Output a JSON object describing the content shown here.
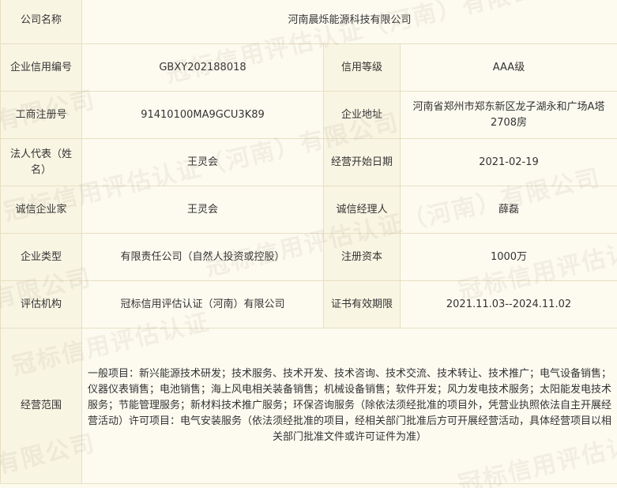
{
  "company": {
    "name_label": "公司名称",
    "name": "河南晨烁能源科技有限公司"
  },
  "credit": {
    "code_label": "企业信用编号",
    "code": "GBXY202188018",
    "level_label": "信用等级",
    "level": "AAA级"
  },
  "registration": {
    "number_label": "工商注册号",
    "number": "91410100MA9GCU3K89",
    "address_label": "企业地址",
    "address": "河南省郑州市郑东新区龙子湖永和广场A塔2708房"
  },
  "legal": {
    "rep_label": "法人代表（姓名）",
    "rep": "王灵会",
    "start_label": "经营开始日期",
    "start": "2021-02-19"
  },
  "integrity": {
    "entrepreneur_label": "诚信企业家",
    "entrepreneur": "王灵会",
    "manager_label": "诚信经理人",
    "manager": "薛磊"
  },
  "type": {
    "type_label": "企业类型",
    "type": "有限责任公司（自然人投资或控股）",
    "capital_label": "注册资本",
    "capital": "1000万"
  },
  "evaluation": {
    "org_label": "评估机构",
    "org": "冠标信用评估认证（河南）有限公司",
    "validity_label": "证书有效期限",
    "validity": "2021.11.03--2024.11.02"
  },
  "scope": {
    "label": "经营范围",
    "text": "一般项目：新兴能源技术研发；技术服务、技术开发、技术咨询、技术交流、技术转让、技术推广；电气设备销售；仪器仪表销售；电池销售；海上风电相关装备销售；机械设备销售；软件开发；风力发电技术服务；太阳能发电技术服务；节能管理服务；新材料技术推广服务；环保咨询服务（除依法须经批准的项目外，凭营业执照依法自主开展经营活动）许可项目：电气安装服务（依法须经批准的项目，经相关部门批准后方可开展经营活动，具体经营项目以相关部门批准文件或许可证件为准）"
  },
  "watermark": {
    "full": "冠标信用评估认证（河南）有限公司",
    "tail": "有限公司",
    "head": "冠标信用评估认证"
  }
}
